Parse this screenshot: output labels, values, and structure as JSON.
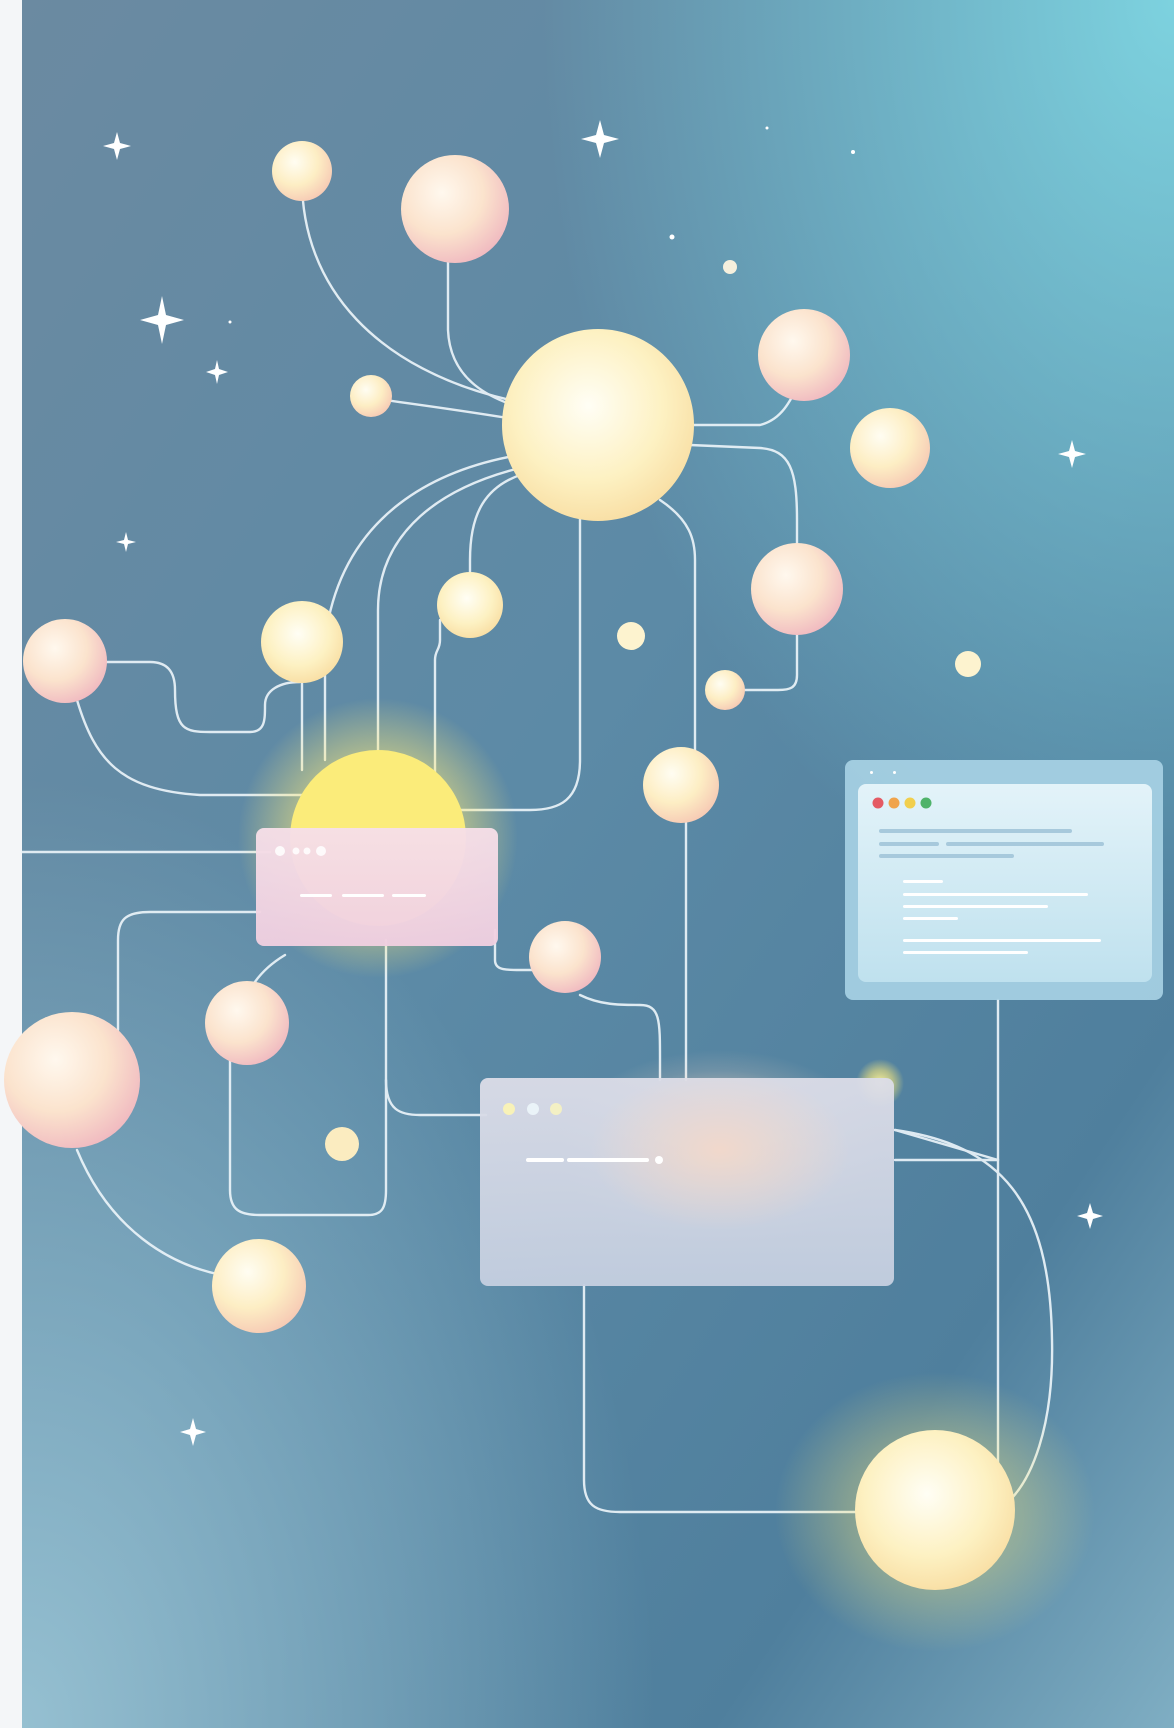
{
  "scene": {
    "description_free": true,
    "palette": {
      "bg_top_left": "#6f8fa6",
      "bg_top_right": "#7ccfdc",
      "bg_mid": "#5f8ba6",
      "bg_bottom": "#8fbccd",
      "line": "#eef6fb",
      "orb_light": "#fffbe6",
      "orb_warm": "#fde7b8",
      "orb_pink": "#f7d3d3",
      "glow": "#fff2a8",
      "card_pink": "#f3d6e2",
      "card_lavender": "#cdd3e3",
      "card_blue": "#cfe9f4",
      "dot_red": "#e45a63",
      "dot_orange": "#f0a44b",
      "dot_yellow": "#f1cf4d",
      "dot_green": "#4fb36a"
    }
  },
  "windows": [
    {
      "name": "pink-window",
      "dots": 3,
      "text_lines": 3
    },
    {
      "name": "lavender-window",
      "dots": 3,
      "text_lines": 3
    },
    {
      "name": "blue-window",
      "dots": 4,
      "text_lines": 8
    }
  ],
  "icons": {
    "sparkle": "sparkle-icon",
    "orb": "orb-icon",
    "window": "window-icon"
  }
}
